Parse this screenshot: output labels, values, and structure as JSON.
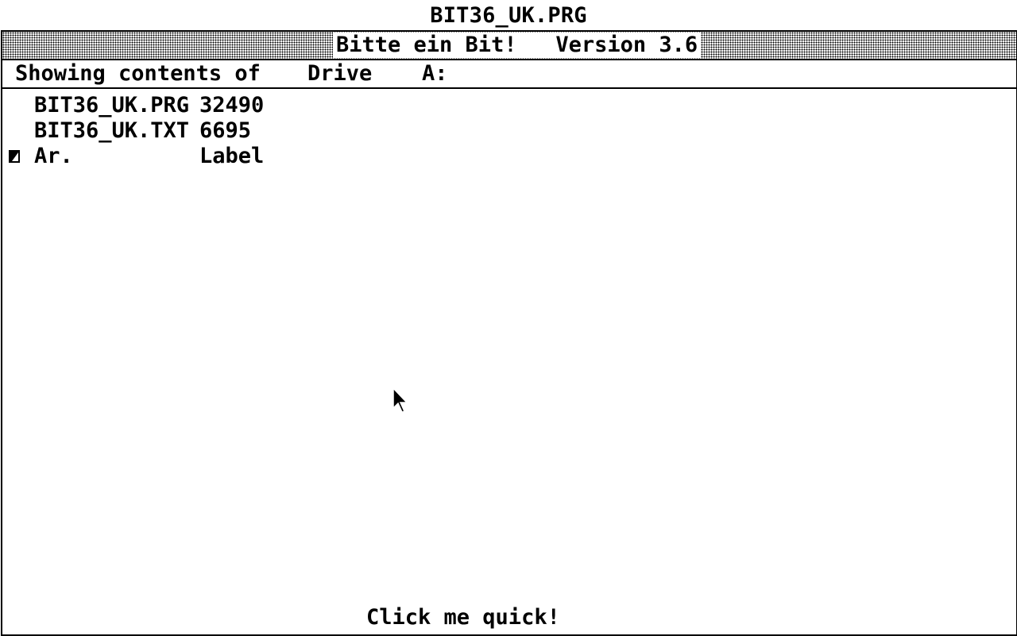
{
  "app": {
    "title": "BIT36_UK.PRG"
  },
  "window": {
    "title": "Bitte ein Bit!   Version 3.6"
  },
  "info_bar": {
    "label": "Showing contents of",
    "drive_label": "Drive",
    "drive_value": "A:"
  },
  "files": [
    {
      "name": "BIT36_UK.PRG",
      "size": "32490"
    },
    {
      "name": "BIT36_UK.TXT",
      "size": "6695"
    },
    {
      "name": "Ar.",
      "size": "Label"
    }
  ],
  "status": {
    "text": "Click me quick!"
  },
  "colors": {
    "foreground": "#000000",
    "background": "#ffffff"
  },
  "icons": {
    "cursor": "arrow-pointer-icon",
    "row_marker": "folder-marker-icon"
  }
}
